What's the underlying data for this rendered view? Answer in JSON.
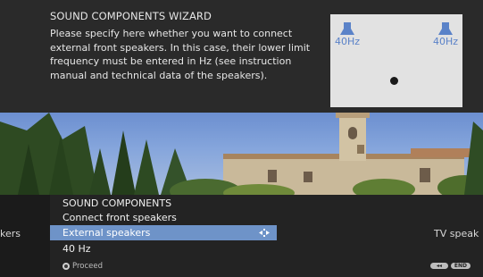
{
  "wizard": {
    "title": "SOUND COMPONENTS WIZARD",
    "description": "Please specify here whether you want to connect external front speakers. In this case, their lower limit frequency must be entered in Hz (see instruction manual and technical data of the speakers).",
    "left_speaker_freq": "40Hz",
    "right_speaker_freq": "40Hz"
  },
  "menu": {
    "title": "SOUND COMPONENTS",
    "subtitle": "Connect front speakers",
    "prev_option": "kers",
    "selected_option": "External speakers",
    "next_option": "TV speak",
    "value": "40 Hz",
    "footer_label": "Proceed",
    "back_label": "◂◂",
    "end_label": "END"
  },
  "colors": {
    "selection": "#6e93c8",
    "speaker_accent": "#5a82c8",
    "panel": "#2a2a2a"
  },
  "icons": {
    "speaker": "speaker-icon",
    "arrows": "left-right-arrows-icon",
    "ok": "ok-button-icon"
  }
}
